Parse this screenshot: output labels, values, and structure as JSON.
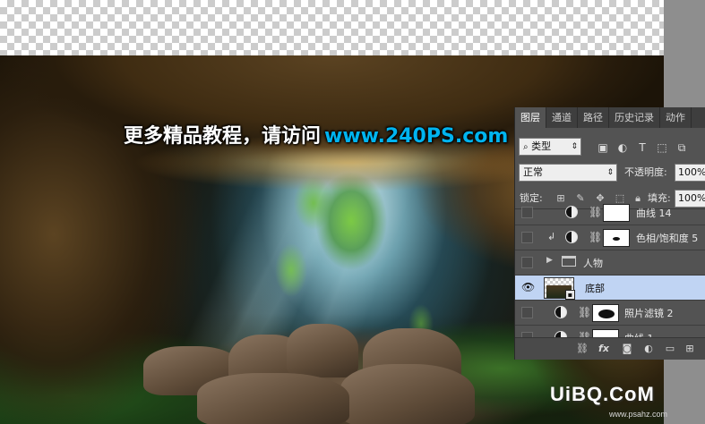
{
  "caption": {
    "chinese": "更多精品教程，请访问",
    "url": "www.240PS.com"
  },
  "panel": {
    "tabs": [
      "图层",
      "通道",
      "路径",
      "历史记录",
      "动作"
    ],
    "active_tab": "图层",
    "filter_kind": "类型",
    "blend_mode": "正常",
    "opacity_label": "不透明度:",
    "opacity_value": "100%",
    "lock_label": "锁定:",
    "fill_label": "填充:",
    "fill_value": "100%",
    "layers": [
      {
        "name": "曲线 14",
        "type": "adjustment",
        "visible": false
      },
      {
        "name": "色相/饱和度 5",
        "type": "adjustment",
        "visible": false,
        "clipped": true
      },
      {
        "name": "人物",
        "type": "group",
        "visible": false
      },
      {
        "name": "底部",
        "type": "smart-object",
        "visible": true,
        "selected": true
      },
      {
        "name": "照片滤镜 2",
        "type": "adjustment",
        "visible": false
      },
      {
        "name": "曲线 1",
        "type": "adjustment",
        "visible": false
      }
    ],
    "bottom_icons": [
      "link-icon",
      "fx-icon",
      "mask-icon",
      "adjustment-icon",
      "folder-icon",
      "new-layer-icon",
      "trash-icon"
    ],
    "fx_label": "fx"
  },
  "watermark": {
    "main": "UiBQ.CoM",
    "sub": "www.psahz.com"
  },
  "colors": {
    "panel_bg": "#535353",
    "selected_layer": "#c0d4f3",
    "url_color": "#00b4f0"
  }
}
